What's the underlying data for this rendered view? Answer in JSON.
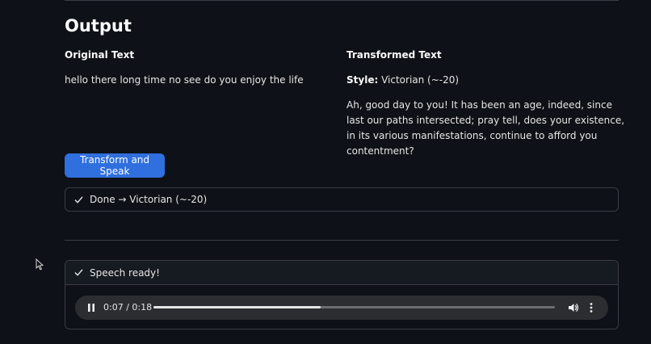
{
  "output": {
    "heading": "Output",
    "original": {
      "title": "Original Text",
      "text": "hello there long time no see do you enjoy the life"
    },
    "transformed": {
      "title": "Transformed Text",
      "style_label": "Style:",
      "style_value": "Victorian (~-20)",
      "text": "Ah, good day to you! It has been an age, indeed, since last our paths intersected; pray tell, does your existence, in its various manifestations, continue to afford you contentment?"
    }
  },
  "transform_button": {
    "label": "Transform and Speak"
  },
  "status": {
    "icon": "check-icon",
    "text": "Done → Victorian (~-20)"
  },
  "speech": {
    "icon": "check-icon",
    "status_text": "Speech ready!",
    "player": {
      "time_display": "0:07 / 0:18",
      "progress": 0.4167,
      "play_icon": "pause-icon",
      "volume_icon": "volume-icon",
      "menu_icon": "more-vertical-icon"
    }
  },
  "colors": {
    "background": "#0e1117",
    "accent": "#2f6fde",
    "border": "#3a3d45"
  }
}
